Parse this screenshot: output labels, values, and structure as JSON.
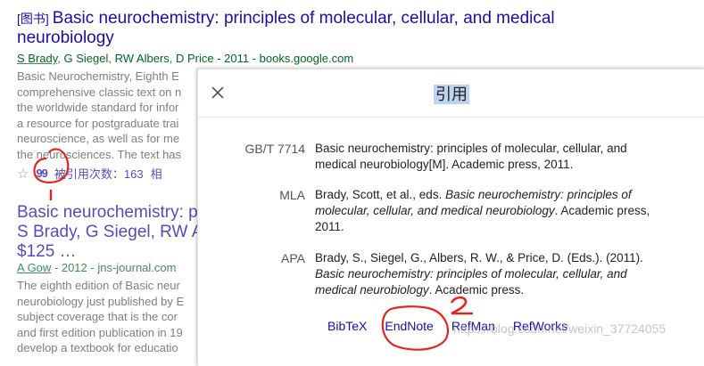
{
  "result1": {
    "tag": "[图书]",
    "title": "Basic neurochemistry: principles of molecular, cellular, and medical neurobiology",
    "author_link": "S Brady",
    "meta_rest": ", G Siegel, RW Albers, D Price - 2011 - books.google.com",
    "snippet_lines": [
      "Basic Neurochemistry, Eighth E",
      "comprehensive classic text on n",
      "the worldwide standard for infor",
      "a resource for postgraduate trai",
      "neuroscience, as well as for me",
      "the neurosciences. The text has"
    ],
    "cited_by": "被引用次数：163",
    "related": "相"
  },
  "result2": {
    "title_line1": "Basic neurochemistry: p",
    "title_line2": "S Brady, G Siegel, RW A",
    "title_line3": "$125 …",
    "author_link": "A Gow",
    "meta_rest": " - 2012 - jns-journal.com",
    "snippet_lines": [
      "The eighth edition of Basic neur",
      "neurobiology just published by E",
      "subject coverage that is the cor",
      "and first edition publication in 19",
      "develop a textbook for educatio"
    ]
  },
  "dialog": {
    "title": "引用",
    "citations": [
      {
        "format": "GB/T 7714",
        "line1": "Basic neurochemistry: principles of molecular, cellular, and",
        "line2": "medical neurobiology[M]. Academic press, 2011."
      },
      {
        "format": "MLA",
        "pre": "Brady, Scott, et al., eds. ",
        "italic": "Basic neurochemistry: principles of molecular, cellular, and medical neurobiology",
        "post": ". Academic press, 2011."
      },
      {
        "format": "APA",
        "pre": "Brady, S., Siegel, G., Albers, R. W., & Price, D. (Eds.). (2011). ",
        "italic": "Basic neurochemistry: principles of molecular, cellular, and medical neurobiology",
        "post": ". Academic press."
      }
    ],
    "export_links": [
      "BibTeX",
      "EndNote",
      "RefMan",
      "RefWorks"
    ]
  },
  "watermark": "https://blog.csdn.net/weixin_37724055",
  "annotations": [
    "1",
    "2"
  ],
  "colors": {
    "link": "#1a0dab",
    "green": "#006621",
    "annotation": "#e8231c"
  }
}
